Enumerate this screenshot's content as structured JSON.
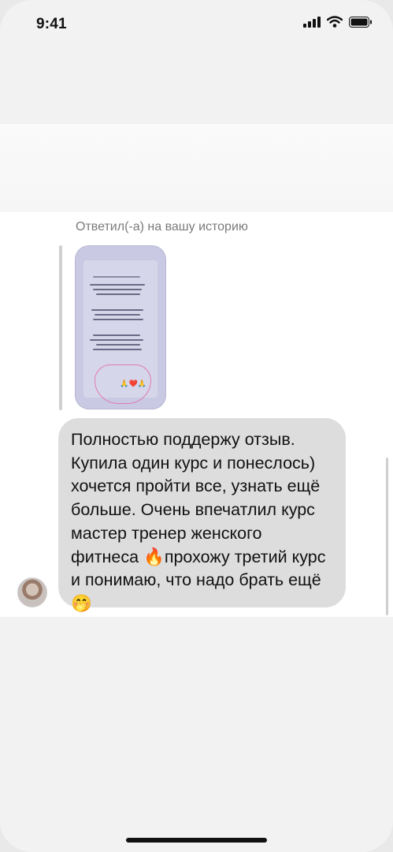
{
  "status_bar": {
    "time": "9:41",
    "icons": [
      "signal-icon",
      "wifi-icon",
      "battery-icon"
    ]
  },
  "message": {
    "reply_caption": "Ответил(-а) на вашу историю",
    "story_preview": {
      "icon": "story-thumbnail-icon"
    },
    "text": "Полностью поддержу отзыв. Купила один курс и понеслось) хочется пройти все, узнать ещё больше. Очень впечатлил курс мастер тренер женского фитнеса 🔥прохожу третий курс и понимаю, что надо брать ещё 🤭"
  },
  "colors": {
    "bubble": "#dddddd",
    "caption": "#7a7a7a",
    "background": "#f2f2f2"
  }
}
